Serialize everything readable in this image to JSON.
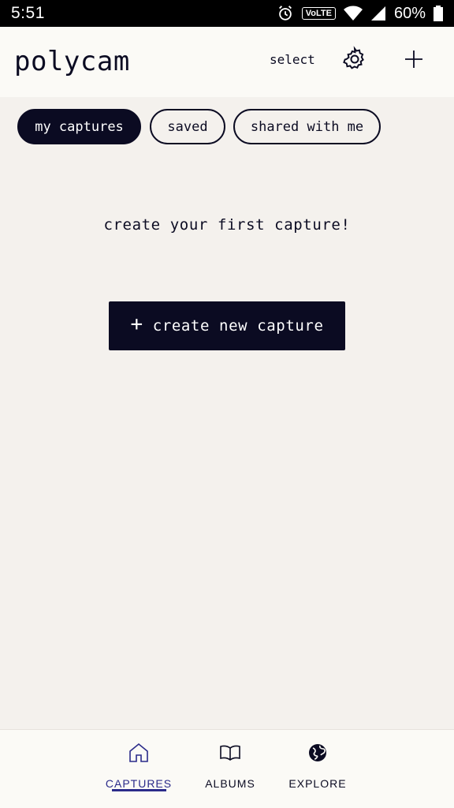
{
  "status_bar": {
    "time": "5:51",
    "volte": "VoLTE",
    "battery": "60%"
  },
  "header": {
    "title": "polycam",
    "select_label": "select",
    "icons": [
      "gear-icon",
      "plus-icon"
    ]
  },
  "tabs": [
    {
      "label": "my captures",
      "active": true
    },
    {
      "label": "saved",
      "active": false
    },
    {
      "label": "shared with me",
      "active": false
    }
  ],
  "empty_state": {
    "message": "create your first capture!",
    "button_label": "create new capture"
  },
  "bottom_nav": [
    {
      "label": "CAPTURES",
      "icon": "home-icon",
      "active": true
    },
    {
      "label": "ALBUMS",
      "icon": "book-icon",
      "active": false
    },
    {
      "label": "EXPLORE",
      "icon": "globe-icon",
      "active": false
    }
  ],
  "colors": {
    "accent": "#2b2b8a",
    "primary": "#0b0b22",
    "background": "#f4f1ed"
  }
}
